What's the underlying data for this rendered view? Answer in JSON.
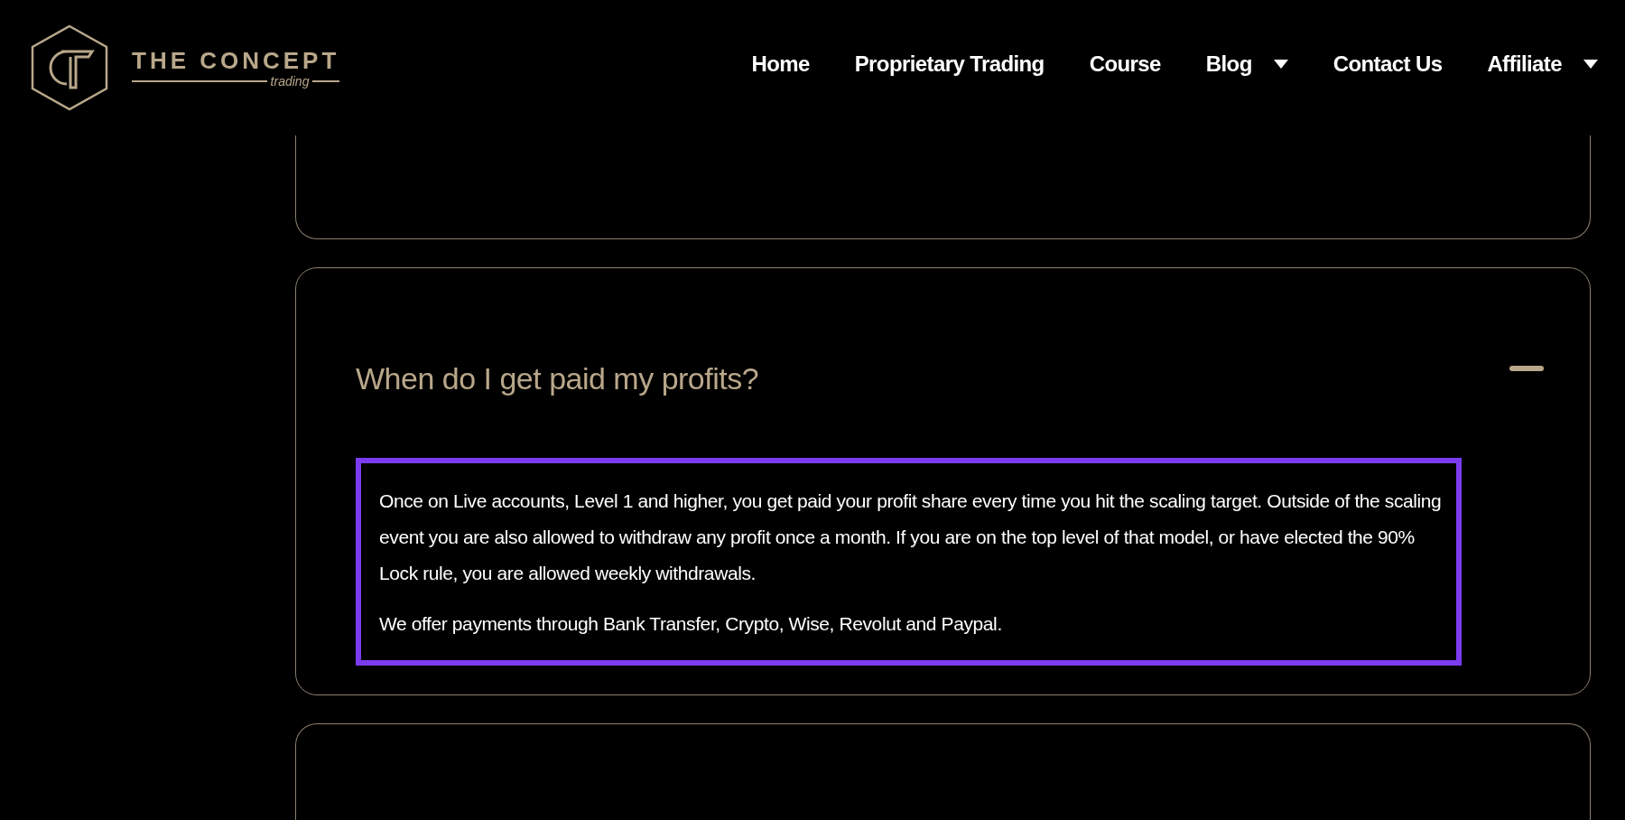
{
  "logo": {
    "title": "THE CONCEPT",
    "subtitle": "trading"
  },
  "nav": [
    {
      "label": "Home",
      "has_dropdown": false
    },
    {
      "label": "Proprietary Trading",
      "has_dropdown": false
    },
    {
      "label": "Course",
      "has_dropdown": false
    },
    {
      "label": "Blog",
      "has_dropdown": true
    },
    {
      "label": "Contact Us",
      "has_dropdown": false
    },
    {
      "label": "Affiliate",
      "has_dropdown": true
    }
  ],
  "faq": {
    "question": "When do I get paid my profits?",
    "expanded": true,
    "highlighted": true,
    "answer": [
      "Once on Live accounts, Level 1 and higher, you get paid your profit share every time you hit the scaling target. Outside of the scaling event you are also allowed to withdraw any profit once a month. If you are on the top level of that model, or have elected the 90% Lock rule, you are allowed weekly withdrawals.",
      "We offer payments through Bank Transfer, Crypto, Wise, Revolut and Paypal."
    ]
  }
}
